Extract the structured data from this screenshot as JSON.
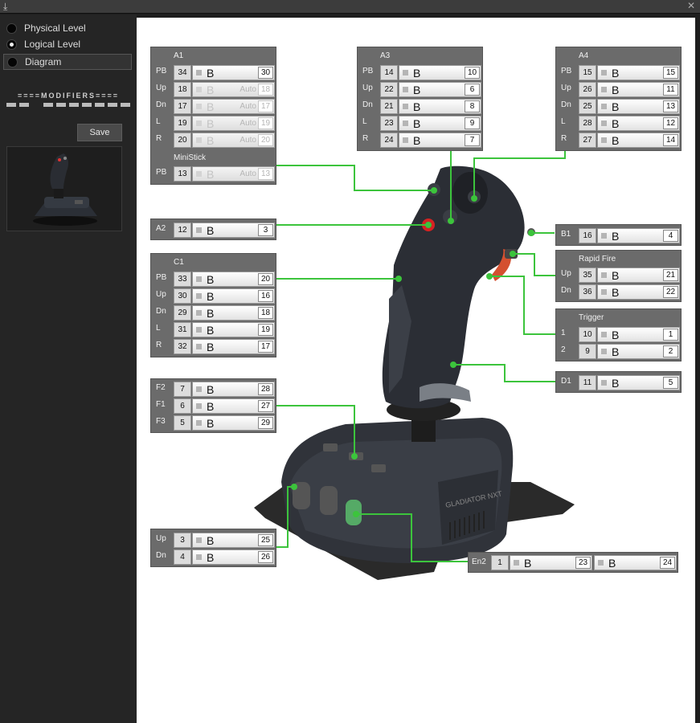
{
  "window": {
    "app_icon": "joystick-app-icon",
    "close": "✕"
  },
  "sidebar": {
    "radios": [
      {
        "label": "Physical Level",
        "checked": false
      },
      {
        "label": "Logical Level",
        "checked": true
      },
      {
        "label": "Diagram",
        "checked": false
      }
    ],
    "modifiers_title": "====MODIFIERS====",
    "save_label": "Save",
    "thumbnail": "joystick-thumbnail"
  },
  "panels": {
    "a1": {
      "title": "A1",
      "rows": [
        {
          "label": "PB",
          "num": "34",
          "b": "B",
          "value": "30"
        },
        {
          "label": "Up",
          "num": "18",
          "b": "B",
          "auto": "Auto",
          "value": "18"
        },
        {
          "label": "Dn",
          "num": "17",
          "b": "B",
          "auto": "Auto",
          "value": "17"
        },
        {
          "label": "L",
          "num": "19",
          "b": "B",
          "auto": "Auto",
          "value": "19"
        },
        {
          "label": "R",
          "num": "20",
          "b": "B",
          "auto": "Auto",
          "value": "20"
        }
      ],
      "subtitle": "MiniStick",
      "sub_rows": [
        {
          "label": "PB",
          "num": "13",
          "b": "B",
          "auto": "Auto",
          "value": "13"
        }
      ]
    },
    "a3": {
      "title": "A3",
      "rows": [
        {
          "label": "PB",
          "num": "14",
          "b": "B",
          "value": "10"
        },
        {
          "label": "Up",
          "num": "22",
          "b": "B",
          "value": "6"
        },
        {
          "label": "Dn",
          "num": "21",
          "b": "B",
          "value": "8"
        },
        {
          "label": "L",
          "num": "23",
          "b": "B",
          "value": "9"
        },
        {
          "label": "R",
          "num": "24",
          "b": "B",
          "value": "7"
        }
      ]
    },
    "a4": {
      "title": "A4",
      "rows": [
        {
          "label": "PB",
          "num": "15",
          "b": "B",
          "value": "15"
        },
        {
          "label": "Up",
          "num": "26",
          "b": "B",
          "value": "11"
        },
        {
          "label": "Dn",
          "num": "25",
          "b": "B",
          "value": "13"
        },
        {
          "label": "L",
          "num": "28",
          "b": "B",
          "value": "12"
        },
        {
          "label": "R",
          "num": "27",
          "b": "B",
          "value": "14"
        }
      ]
    },
    "a2": {
      "rows": [
        {
          "label": "A2",
          "num": "12",
          "b": "B",
          "value": "3"
        }
      ]
    },
    "b1": {
      "rows": [
        {
          "label": "B1",
          "num": "16",
          "b": "B",
          "value": "4"
        }
      ]
    },
    "rapid_fire": {
      "title": "Rapid Fire",
      "rows": [
        {
          "label": "Up",
          "num": "35",
          "b": "B",
          "value": "21"
        },
        {
          "label": "Dn",
          "num": "36",
          "b": "B",
          "value": "22"
        }
      ]
    },
    "trigger": {
      "title": "Trigger",
      "rows": [
        {
          "label": "1",
          "num": "10",
          "b": "B",
          "value": "1"
        },
        {
          "label": "2",
          "num": "9",
          "b": "B",
          "value": "2"
        }
      ]
    },
    "d1": {
      "rows": [
        {
          "label": "D1",
          "num": "11",
          "b": "B",
          "value": "5"
        }
      ]
    },
    "c1": {
      "title": "C1",
      "rows": [
        {
          "label": "PB",
          "num": "33",
          "b": "B",
          "value": "20"
        },
        {
          "label": "Up",
          "num": "30",
          "b": "B",
          "value": "16"
        },
        {
          "label": "Dn",
          "num": "29",
          "b": "B",
          "value": "18"
        },
        {
          "label": "L",
          "num": "31",
          "b": "B",
          "value": "19"
        },
        {
          "label": "R",
          "num": "32",
          "b": "B",
          "value": "17"
        }
      ]
    },
    "f": {
      "rows": [
        {
          "label": "F2",
          "num": "7",
          "b": "B",
          "value": "28"
        },
        {
          "label": "F1",
          "num": "6",
          "b": "B",
          "value": "27"
        },
        {
          "label": "F3",
          "num": "5",
          "b": "B",
          "value": "29"
        }
      ]
    },
    "en1": {
      "rows": [
        {
          "label": "Up",
          "num": "3",
          "b": "B",
          "value": "25"
        },
        {
          "label": "Dn",
          "num": "4",
          "b": "B",
          "value": "26"
        }
      ]
    },
    "en2": {
      "label": "En2",
      "num": "1",
      "b1": "B",
      "value1": "23",
      "b2": "B",
      "value2": "24"
    }
  },
  "device": {
    "name": "joystick-device-diagram",
    "brand_text": "GLADIATOR NXT",
    "connector_color": "#3cc43c"
  }
}
